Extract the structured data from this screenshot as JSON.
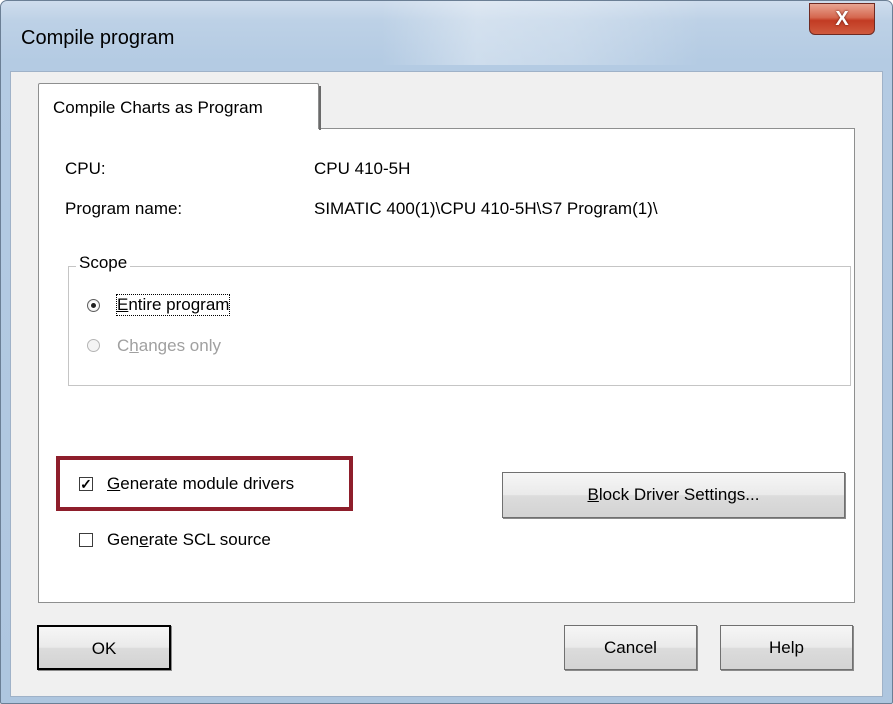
{
  "window": {
    "title": "Compile program",
    "close_label": "X"
  },
  "tab": {
    "label": "Compile Charts as Program"
  },
  "info": {
    "cpu_label": "CPU:",
    "cpu_value": "CPU 410-5H",
    "program_label": "Program name:",
    "program_value": "SIMATIC 400(1)\\CPU 410-5H\\S7 Program(1)\\"
  },
  "scope": {
    "title": "Scope",
    "options": [
      {
        "label_mnemonic": "E",
        "label_rest": "ntire program",
        "selected": true,
        "enabled": true
      },
      {
        "label_prefix": "C",
        "label_mnemonic": "h",
        "label_rest": "anges only",
        "selected": false,
        "enabled": false
      }
    ]
  },
  "options": {
    "generate_module_drivers": {
      "label_mnemonic": "G",
      "label_rest": "enerate module drivers",
      "checked": true
    },
    "generate_scl_source": {
      "label_prefix": "Gen",
      "label_mnemonic": "e",
      "label_rest": "rate SCL source",
      "checked": false
    }
  },
  "block_driver_button": {
    "label_mnemonic": "B",
    "label_rest": "lock Driver Settings..."
  },
  "footer": {
    "ok_label": "OK",
    "cancel_label": "Cancel",
    "help_label": "Help"
  },
  "colors": {
    "highlight_border": "#8e1e2b",
    "close_button": "#c8442b",
    "titlebar": "#bdd1e6"
  }
}
